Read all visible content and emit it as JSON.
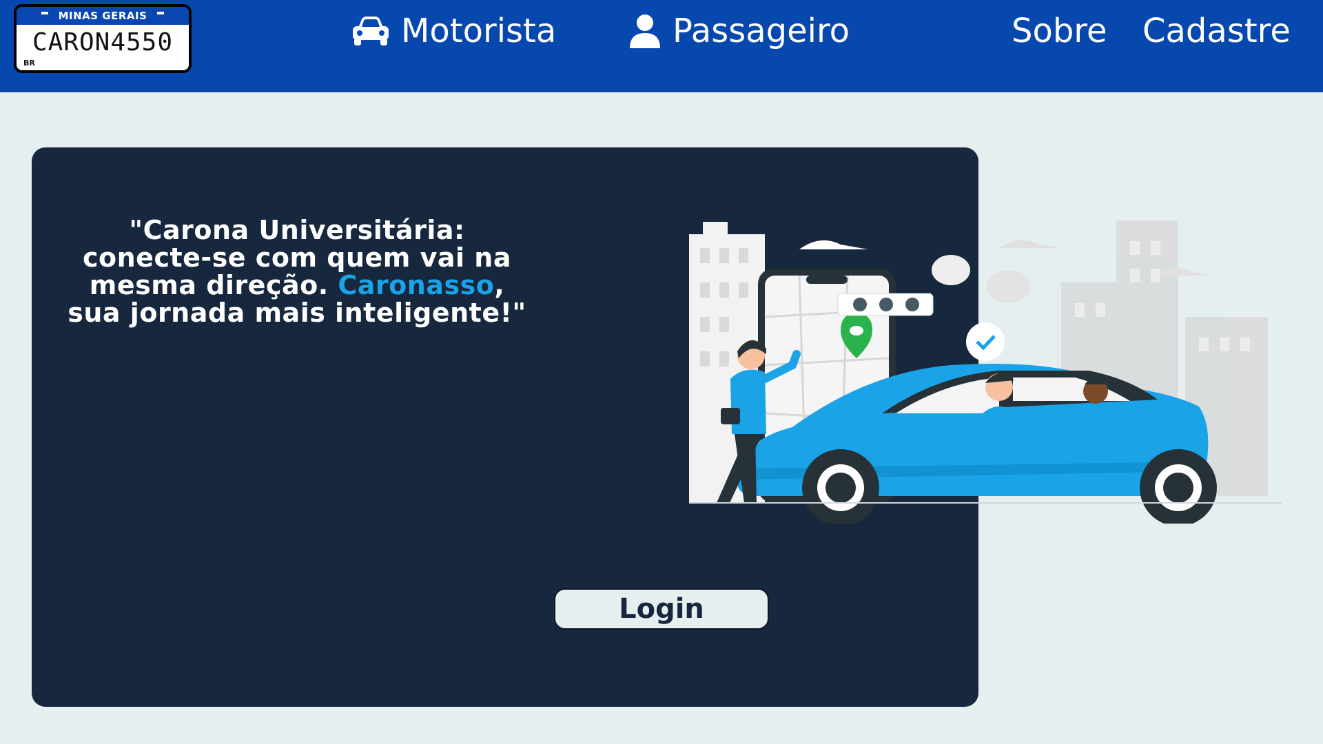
{
  "header": {
    "logo": {
      "state": "MINAS GERAIS",
      "plate_number": "CARON4550",
      "country": "BR"
    },
    "nav": {
      "motorista": "Motorista",
      "passageiro": "Passageiro",
      "sobre": "Sobre",
      "cadastre": "Cadastre"
    },
    "icons": {
      "motorista": "car-icon",
      "passageiro": "user-icon"
    }
  },
  "hero": {
    "quote_part1": "\"Carona Universitária: conecte-se com quem vai na mesma direção.",
    "brand": "Caronasso",
    "quote_part2": ", sua jornada mais inteligente!\"",
    "login_label": "Login"
  },
  "colors": {
    "header_bg": "#0648ad",
    "page_bg": "#e6eff0",
    "card_bg": "#16273e",
    "brand_accent": "#1aa3e6"
  }
}
